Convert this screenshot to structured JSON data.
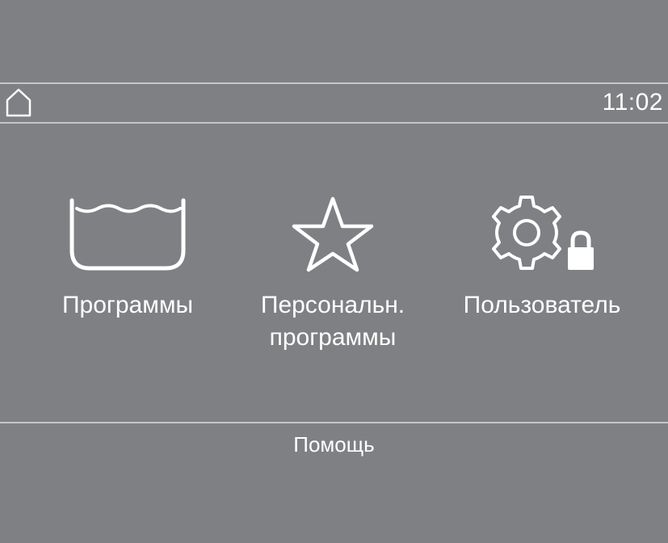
{
  "header": {
    "time": "11:02",
    "home_icon": "home-icon"
  },
  "menu": {
    "items": [
      {
        "label": "Программы",
        "icon": "wash-tub-icon"
      },
      {
        "label": "Персональн.\nпрограммы",
        "icon": "star-icon"
      },
      {
        "label": "Пользователь",
        "icon": "gear-lock-icon"
      }
    ]
  },
  "footer": {
    "help_label": "Помощь"
  },
  "colors": {
    "background": "#7f8083",
    "foreground": "#ffffff",
    "divider": "#c4c5c7"
  }
}
